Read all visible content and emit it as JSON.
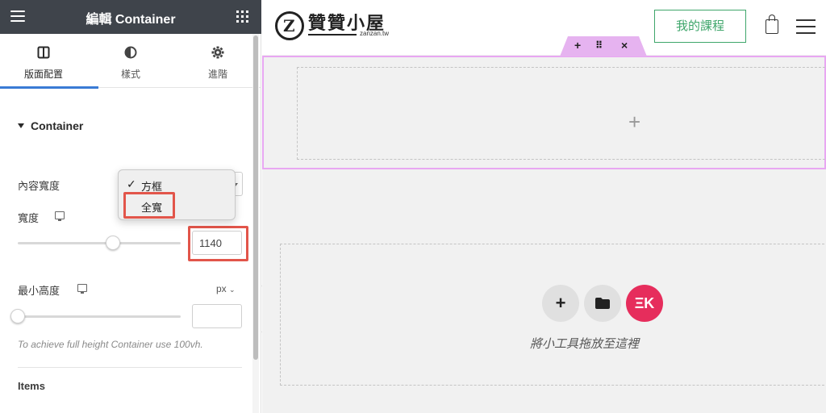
{
  "panel": {
    "title": "編輯 Container",
    "tabs": [
      {
        "label": "版面配置",
        "icon": "layout-icon",
        "active": true
      },
      {
        "label": "樣式",
        "icon": "contrast-icon",
        "active": false
      },
      {
        "label": "進階",
        "icon": "gear-icon",
        "active": false
      }
    ],
    "section_title": "Container",
    "content_width_label": "內容寬度",
    "width_label": "寬度",
    "width_value": "1140",
    "min_height_label": "最小高度",
    "min_height_unit": "px",
    "min_height_value": "",
    "hint": "To achieve full height Container use 100vh.",
    "items_label": "Items"
  },
  "dropdown": {
    "options": [
      "方框",
      "全寬"
    ],
    "checked_index": 0,
    "highlighted_index": 1
  },
  "site": {
    "logo_char": "Z",
    "logo_text": "贊贊小屋",
    "logo_sub": "zanzan.tw",
    "course_button": "我的課程"
  },
  "canvas": {
    "drop_text": "將小工具拖放至這裡"
  },
  "colors": {
    "panel_header": "#3f444b",
    "tab_active": "#3a7bd5",
    "highlight": "#e2554a",
    "selection": "#e8a7f2",
    "course_green": "#3fa66b",
    "elementor_pink": "#e62d5c"
  }
}
